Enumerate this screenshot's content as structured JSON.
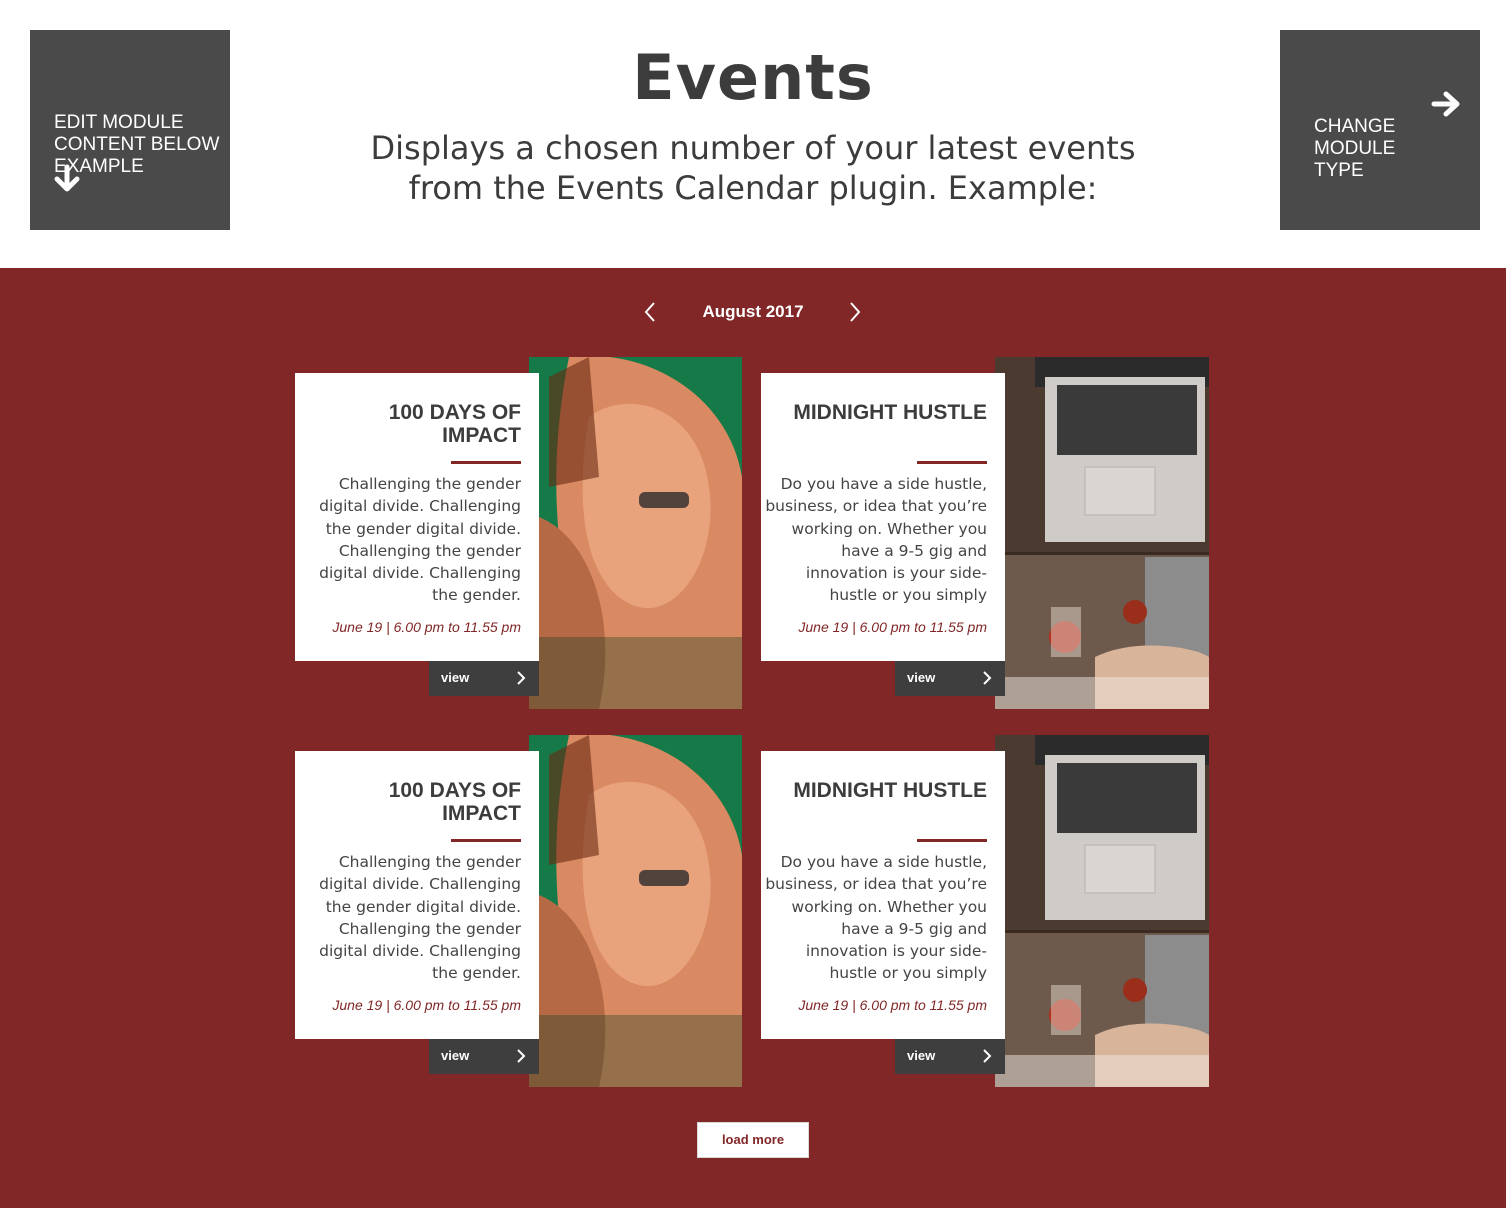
{
  "header": {
    "title": "Events",
    "subtitle_line1": "Displays a chosen number of your latest events",
    "subtitle_line2": "from the Events Calendar plugin. Example:",
    "edit_button_label": "EDIT MODULE CONTENT BELOW EXAMPLE",
    "change_button_label": "CHANGE MODULE TYPE"
  },
  "calendar": {
    "month": "August 2017",
    "load_more_label": "load more",
    "events": [
      {
        "title": "100 DAYS OF IMPACT",
        "description": "Challenging the gender digital divide. Challenging the gender digital divide. Challenging the gender digital divide. Challenging the gender.",
        "date": "June 19 | 6.00 pm to 11.55 pm",
        "view_label": "view",
        "image": "portrait-photo"
      },
      {
        "title": "MIDNIGHT HUSTLE",
        "description": "Do you have a side hustle, business, or idea that you’re working on. Whether you have a 9-5 gig and innovation is your side-hustle or you simply",
        "date": "June 19 | 6.00 pm to 11.55 pm",
        "view_label": "view",
        "image": "laptop-desk-photo"
      },
      {
        "title": "100 DAYS OF IMPACT",
        "description": "Challenging the gender digital divide. Challenging the gender digital divide. Challenging the gender digital divide. Challenging the gender.",
        "date": "June 19 | 6.00 pm to 11.55 pm",
        "view_label": "view",
        "image": "portrait-photo"
      },
      {
        "title": "MIDNIGHT HUSTLE",
        "description": "Do you have a side hustle, business, or idea that you’re working on. Whether you have a 9-5 gig and innovation is your side-hustle or you simply",
        "date": "June 19 | 6.00 pm to 11.55 pm",
        "view_label": "view",
        "image": "laptop-desk-photo"
      }
    ]
  },
  "icons": {
    "edit": "arrow-down-icon",
    "change": "arrow-right-icon",
    "prev": "chevron-left-icon",
    "next": "chevron-right-icon",
    "view": "chevron-right-icon"
  },
  "colors": {
    "accent": "#812727",
    "dark_button": "#4a4a4a",
    "text_dark": "#3c3c3c"
  }
}
